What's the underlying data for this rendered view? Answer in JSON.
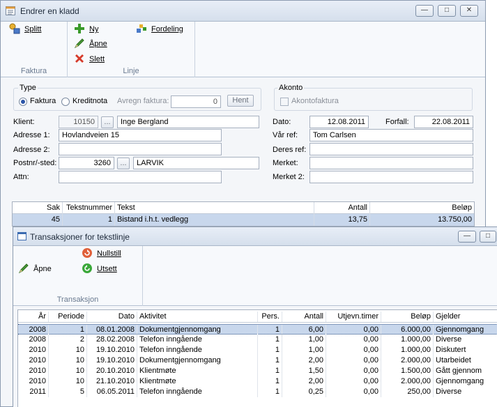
{
  "window": {
    "title": "Endrer en kladd",
    "minimize_glyph": "—",
    "maximize_glyph": "□",
    "close_glyph": "✕"
  },
  "ribbon": {
    "faktura_group": {
      "label": "Faktura",
      "split": "Splitt"
    },
    "linje_group": {
      "label": "Linje",
      "ny": "Ny",
      "apne": "Åpne",
      "slett": "Slett",
      "fordeling": "Fordeling"
    }
  },
  "type_section": {
    "legend": "Type",
    "faktura": "Faktura",
    "kreditnota": "Kreditnota",
    "selected": "Faktura",
    "avregn_label": "Avregn faktura:",
    "avregn_value": "0",
    "hent": "Hent"
  },
  "akonto_section": {
    "legend": "Akonto",
    "checkbox_label": "Akontofaktura"
  },
  "form": {
    "klient_label": "Klient:",
    "klient_no": "10150",
    "klient_name": "Inge Bergland",
    "adresse1_label": "Adresse 1:",
    "adresse1": "Hovlandveien 15",
    "adresse2_label": "Adresse 2:",
    "adresse2": "",
    "postnr_label": "Postnr/-sted:",
    "postnr": "3260",
    "sted": "LARVIK",
    "attn_label": "Attn:",
    "attn": "",
    "browse": "...",
    "dato_label": "Dato:",
    "dato": "12.08.2011",
    "forfall_label": "Forfall:",
    "forfall": "22.08.2011",
    "var_ref_label": "Vår ref:",
    "var_ref": "Tom Carlsen",
    "deres_ref_label": "Deres ref:",
    "deres_ref": "",
    "merket_label": "Merket:",
    "merket": "",
    "merket2_label": "Merket 2:",
    "merket2": ""
  },
  "lines_grid": {
    "headers": {
      "sak": "Sak",
      "tekstnummer": "Tekstnummer",
      "tekst": "Tekst",
      "antall": "Antall",
      "belop": "Beløp"
    },
    "rows": [
      {
        "sak": "45",
        "tekstnummer": "1",
        "tekst": "Bistand i.h.t. vedlegg",
        "antall": "13,75",
        "belop": "13.750,00"
      }
    ]
  },
  "trans_window": {
    "title": "Transaksjoner for tekstlinje",
    "group_label": "Transaksjon",
    "apne": "Åpne",
    "nullstill": "Nullstill",
    "utsett": "Utsett"
  },
  "trans_grid": {
    "headers": {
      "ar": "År",
      "periode": "Periode",
      "dato": "Dato",
      "aktivitet": "Aktivitet",
      "pers": "Pers.",
      "antall": "Antall",
      "utjevn": "Utjevn.timer",
      "belop": "Beløp",
      "gjelder": "Gjelder"
    },
    "rows": [
      {
        "ar": "2008",
        "periode": "1",
        "dato": "08.01.2008",
        "aktivitet": "Dokumentgjennomgang",
        "pers": "1",
        "antall": "6,00",
        "utjevn": "0,00",
        "belop": "6.000,00",
        "gjelder": "Gjennomgang"
      },
      {
        "ar": "2008",
        "periode": "2",
        "dato": "28.02.2008",
        "aktivitet": "Telefon inngående",
        "pers": "1",
        "antall": "1,00",
        "utjevn": "0,00",
        "belop": "1.000,00",
        "gjelder": "Diverse"
      },
      {
        "ar": "2010",
        "periode": "10",
        "dato": "19.10.2010",
        "aktivitet": "Telefon inngående",
        "pers": "1",
        "antall": "1,00",
        "utjevn": "0,00",
        "belop": "1.000,00",
        "gjelder": "Diskutert"
      },
      {
        "ar": "2010",
        "periode": "10",
        "dato": "19.10.2010",
        "aktivitet": "Dokumentgjennomgang",
        "pers": "1",
        "antall": "2,00",
        "utjevn": "0,00",
        "belop": "2.000,00",
        "gjelder": "Utarbeidet"
      },
      {
        "ar": "2010",
        "periode": "10",
        "dato": "20.10.2010",
        "aktivitet": "Klientmøte",
        "pers": "1",
        "antall": "1,50",
        "utjevn": "0,00",
        "belop": "1.500,00",
        "gjelder": "Gått gjennom"
      },
      {
        "ar": "2010",
        "periode": "10",
        "dato": "21.10.2010",
        "aktivitet": "Klientmøte",
        "pers": "1",
        "antall": "2,00",
        "utjevn": "0,00",
        "belop": "2.000,00",
        "gjelder": "Gjennomgang"
      },
      {
        "ar": "2011",
        "periode": "5",
        "dato": "06.05.2011",
        "aktivitet": "Telefon inngående",
        "pers": "1",
        "antall": "0,25",
        "utjevn": "0,00",
        "belop": "250,00",
        "gjelder": "Diverse"
      }
    ]
  },
  "colors": {
    "selection": "#c8d7ec",
    "add_green": "#3a9a2a",
    "delete_red": "#d63a2a",
    "pencil_green": "#4a9a3a"
  }
}
